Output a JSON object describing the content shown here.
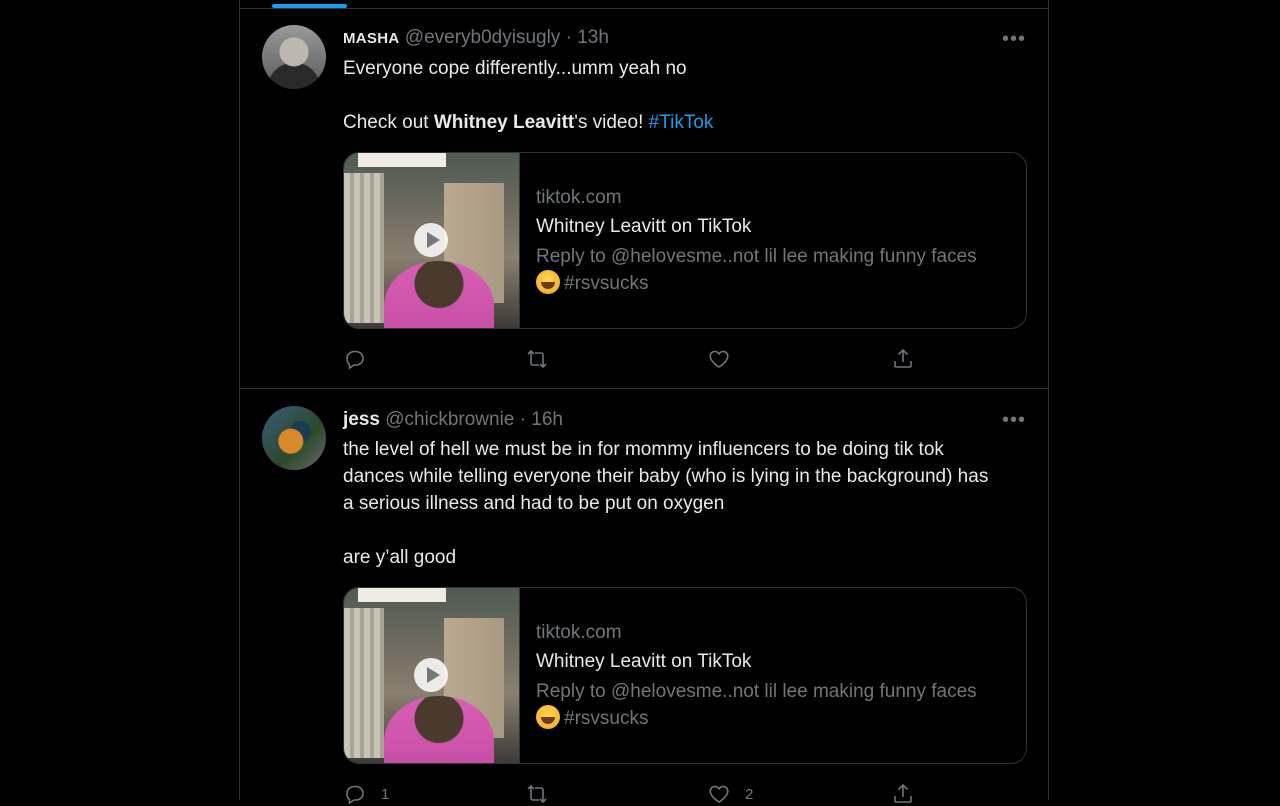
{
  "tweets": [
    {
      "name": "MASHA",
      "handle": "@everyb0dyisugly",
      "separator": "·",
      "time": "13h",
      "more": "•••",
      "text_line1": "Everyone cope differently...umm yeah no",
      "text_line2_prefix": "Check out ",
      "text_line2_bold": "Whitney Leavitt",
      "text_line2_suffix": "'s video! ",
      "hashtag": "#TikTok",
      "card": {
        "domain": "tiktok.com",
        "title": "Whitney Leavitt on TikTok",
        "description_line1": "Reply to @helovesme..not lil lee making funny faces",
        "description_line2": "#rsvsucks"
      },
      "replies": "",
      "retweets": "",
      "likes": ""
    },
    {
      "name": "jess",
      "handle": "@chickbrownie",
      "separator": "·",
      "time": "16h",
      "more": "•••",
      "text_para1": "the level of hell we must be in for mommy influencers to be doing tik tok dances while telling everyone their baby (who is lying in the background) has a serious illness and had to be put on oxygen",
      "text_para2": "are y’all good",
      "card": {
        "domain": "tiktok.com",
        "title": "Whitney Leavitt on TikTok",
        "description_line1": "Reply to @helovesme..not lil lee making funny faces",
        "description_line2": "#rsvsucks"
      },
      "replies": "1",
      "retweets": "",
      "likes": "2"
    }
  ],
  "icons": {
    "reply": "reply-icon",
    "retweet": "retweet-icon",
    "like": "heart-icon",
    "share": "share-icon",
    "more": "more-icon",
    "play": "play-icon",
    "emoji": "laughing-emoji"
  },
  "colors": {
    "background": "#000000",
    "text": "#e7e9ea",
    "secondary": "#71767b",
    "link": "#1d9bf0",
    "border": "#2f3336"
  }
}
